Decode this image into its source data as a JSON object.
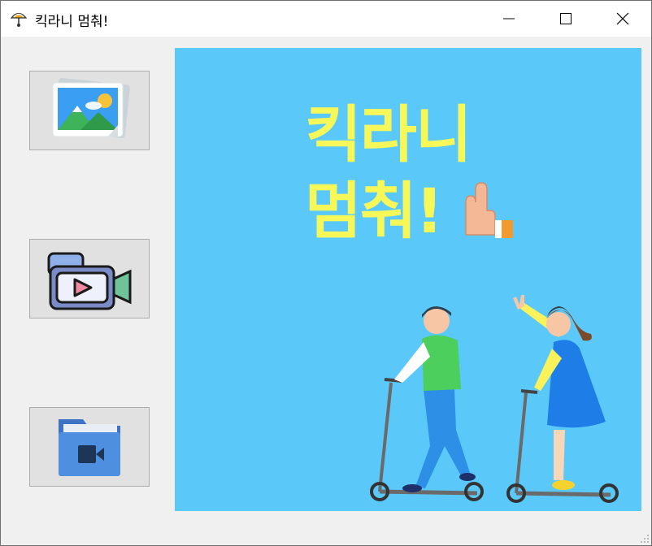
{
  "window": {
    "title": "킥라니 멈춰!",
    "controls": [
      "minimize",
      "maximize",
      "close"
    ]
  },
  "sidebar": {
    "buttons": [
      {
        "name": "image-button",
        "icon": "image-icon"
      },
      {
        "name": "video-camera-button",
        "icon": "video-camera-icon"
      },
      {
        "name": "video-folder-button",
        "icon": "video-folder-icon"
      }
    ]
  },
  "poster": {
    "line1": "킥라니",
    "line2": "멈춰!",
    "background": "#5bc8fa",
    "text_color": "#f6f85a"
  }
}
